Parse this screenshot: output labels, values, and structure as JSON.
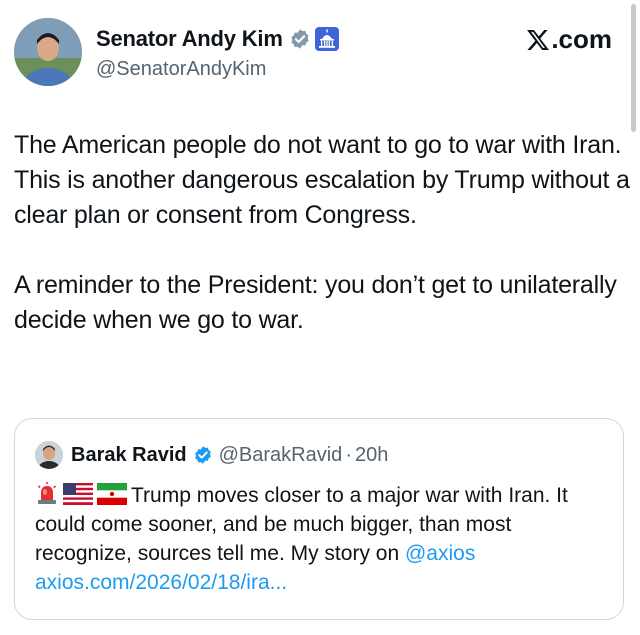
{
  "author": {
    "display_name": "Senator Andy Kim",
    "handle": "@SenatorAndyKim",
    "verified_badge_icon": "verified-badge-icon",
    "government_badge_icon": "capitol-building-icon"
  },
  "brand": {
    "label": ".com",
    "icon": "x-logo-icon"
  },
  "tweet": {
    "paragraph_1": "The American people do not want to go to war with Iran. This is another dangerous escalation by Trump without a clear plan or consent from Congress.",
    "paragraph_2": "A reminder to the President: you don’t get to unilaterally decide when we go to war."
  },
  "quote": {
    "display_name": "Barak Ravid",
    "handle": "@BarakRavid",
    "separator": "·",
    "time": "20h",
    "emojis": [
      "rotating-light-icon",
      "us-flag-icon",
      "iran-flag-icon"
    ],
    "text": "Trump moves closer to a major war with Iran. It could come sooner, and be much bigger, than most recognize, sources tell me. My story on",
    "mention": "@axios",
    "link": "axios.com/2026/02/18/ira..."
  },
  "colors": {
    "link": "#1d9bf0",
    "verified": "#829aab",
    "secondary_text": "#536471",
    "border": "#cfd9de"
  }
}
